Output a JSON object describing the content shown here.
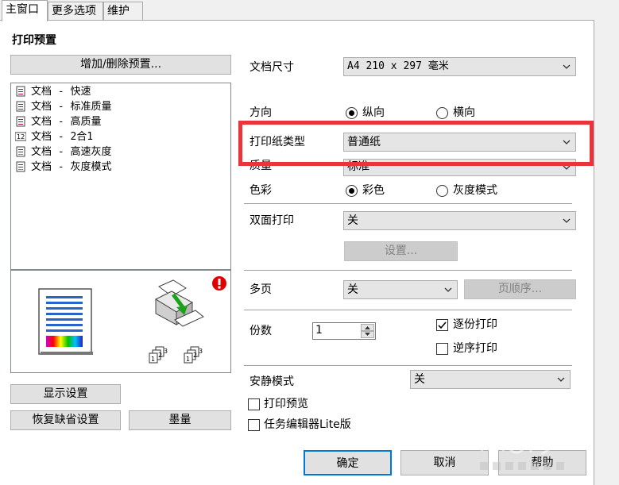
{
  "tabs": [
    {
      "label": "主窗口"
    },
    {
      "label": "更多选项"
    },
    {
      "label": "维护"
    }
  ],
  "presets": {
    "title": "打印预置",
    "add_remove_label": "增加/删除预置...",
    "items": [
      {
        "label": "文档 - 快速",
        "icon": "document-icon"
      },
      {
        "label": "文档 - 标准质量",
        "icon": "document-icon"
      },
      {
        "label": "文档 - 高质量",
        "icon": "document-icon"
      },
      {
        "label": "文档 - 2合1",
        "icon": "two-in-one-icon"
      },
      {
        "label": "文档 - 高速灰度",
        "icon": "document-icon"
      },
      {
        "label": "文档 - 灰度模式",
        "icon": "document-icon"
      }
    ]
  },
  "left_buttons": {
    "show_settings": "显示设置",
    "restore_defaults": "恢复缺省设置",
    "ink_levels": "墨量"
  },
  "settings": {
    "doc_size_label": "文档尺寸",
    "doc_size_value": "A4 210 x 297 毫米",
    "orientation_label": "方向",
    "orientation_portrait": "纵向",
    "orientation_landscape": "横向",
    "paper_type_label": "打印纸类型",
    "paper_type_value": "普通纸",
    "quality_label": "质量",
    "quality_value": "标准",
    "color_label": "色彩",
    "color_color": "彩色",
    "color_gray": "灰度模式",
    "duplex_label": "双面打印",
    "duplex_value": "关",
    "duplex_settings_button": "设置...",
    "multipage_label": "多页",
    "multipage_value": "关",
    "page_order_button": "页顺序...",
    "copies_label": "份数",
    "copies_value": "1",
    "collate_label": "逐份打印",
    "reverse_label": "逆序打印",
    "quiet_mode_label": "安静模式",
    "quiet_mode_value": "关",
    "print_preview_label": "打印预览",
    "job_arranger_label": "任务编辑器Lite版"
  },
  "footer": {
    "ok": "确定",
    "cancel": "取消",
    "help": "帮助"
  },
  "colors": {
    "highlight": "#e8343b",
    "focus_border": "#0078d7"
  }
}
